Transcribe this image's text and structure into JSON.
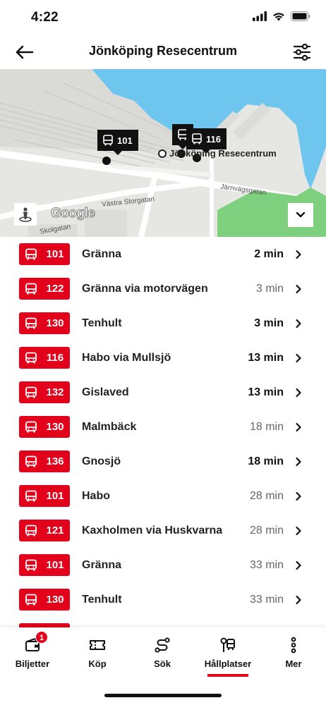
{
  "status_bar": {
    "time": "4:22"
  },
  "header": {
    "title": "Jönköping Resecentrum"
  },
  "map": {
    "station_label": "Jönköping Resecentrum",
    "street_1": "Järnvägsgatan",
    "street_2": "Västra Storgatan",
    "street_3": "Skolgatan",
    "google_label": "Google",
    "markers": [
      {
        "line": "101"
      },
      {
        "line": "116"
      }
    ]
  },
  "departures": [
    {
      "line": "101",
      "destination": "Gränna",
      "time": "2 min",
      "emphasis": "now"
    },
    {
      "line": "122",
      "destination": "Gränna via motorvägen",
      "time": "3 min",
      "emphasis": "later"
    },
    {
      "line": "130",
      "destination": "Tenhult",
      "time": "3 min",
      "emphasis": "now"
    },
    {
      "line": "116",
      "destination": "Habo via Mullsjö",
      "time": "13 min",
      "emphasis": "now"
    },
    {
      "line": "132",
      "destination": "Gislaved",
      "time": "13 min",
      "emphasis": "now"
    },
    {
      "line": "130",
      "destination": "Malmbäck",
      "time": "18 min",
      "emphasis": "later"
    },
    {
      "line": "136",
      "destination": "Gnosjö",
      "time": "18 min",
      "emphasis": "now"
    },
    {
      "line": "101",
      "destination": "Habo",
      "time": "28 min",
      "emphasis": "later"
    },
    {
      "line": "121",
      "destination": "Kaxholmen via Huskvarna",
      "time": "28 min",
      "emphasis": "later"
    },
    {
      "line": "101",
      "destination": "Gränna",
      "time": "33 min",
      "emphasis": "later"
    },
    {
      "line": "130",
      "destination": "Tenhult",
      "time": "33 min",
      "emphasis": "later"
    },
    {
      "line": "",
      "destination": "",
      "time": "",
      "emphasis": "later"
    }
  ],
  "tabs": [
    {
      "label": "Biljetter",
      "icon": "ticket-wallet-icon",
      "badge": "1"
    },
    {
      "label": "Köp",
      "icon": "ticket-icon"
    },
    {
      "label": "Sök",
      "icon": "route-icon"
    },
    {
      "label": "Hållplatser",
      "icon": "bus-stop-icon",
      "active": true
    },
    {
      "label": "Mer",
      "icon": "more-vertical-icon"
    }
  ],
  "colors": {
    "accent": "#e3001b",
    "water": "#6ec6ee",
    "park": "#7ed07e",
    "map_land": "#e6e6e3"
  }
}
